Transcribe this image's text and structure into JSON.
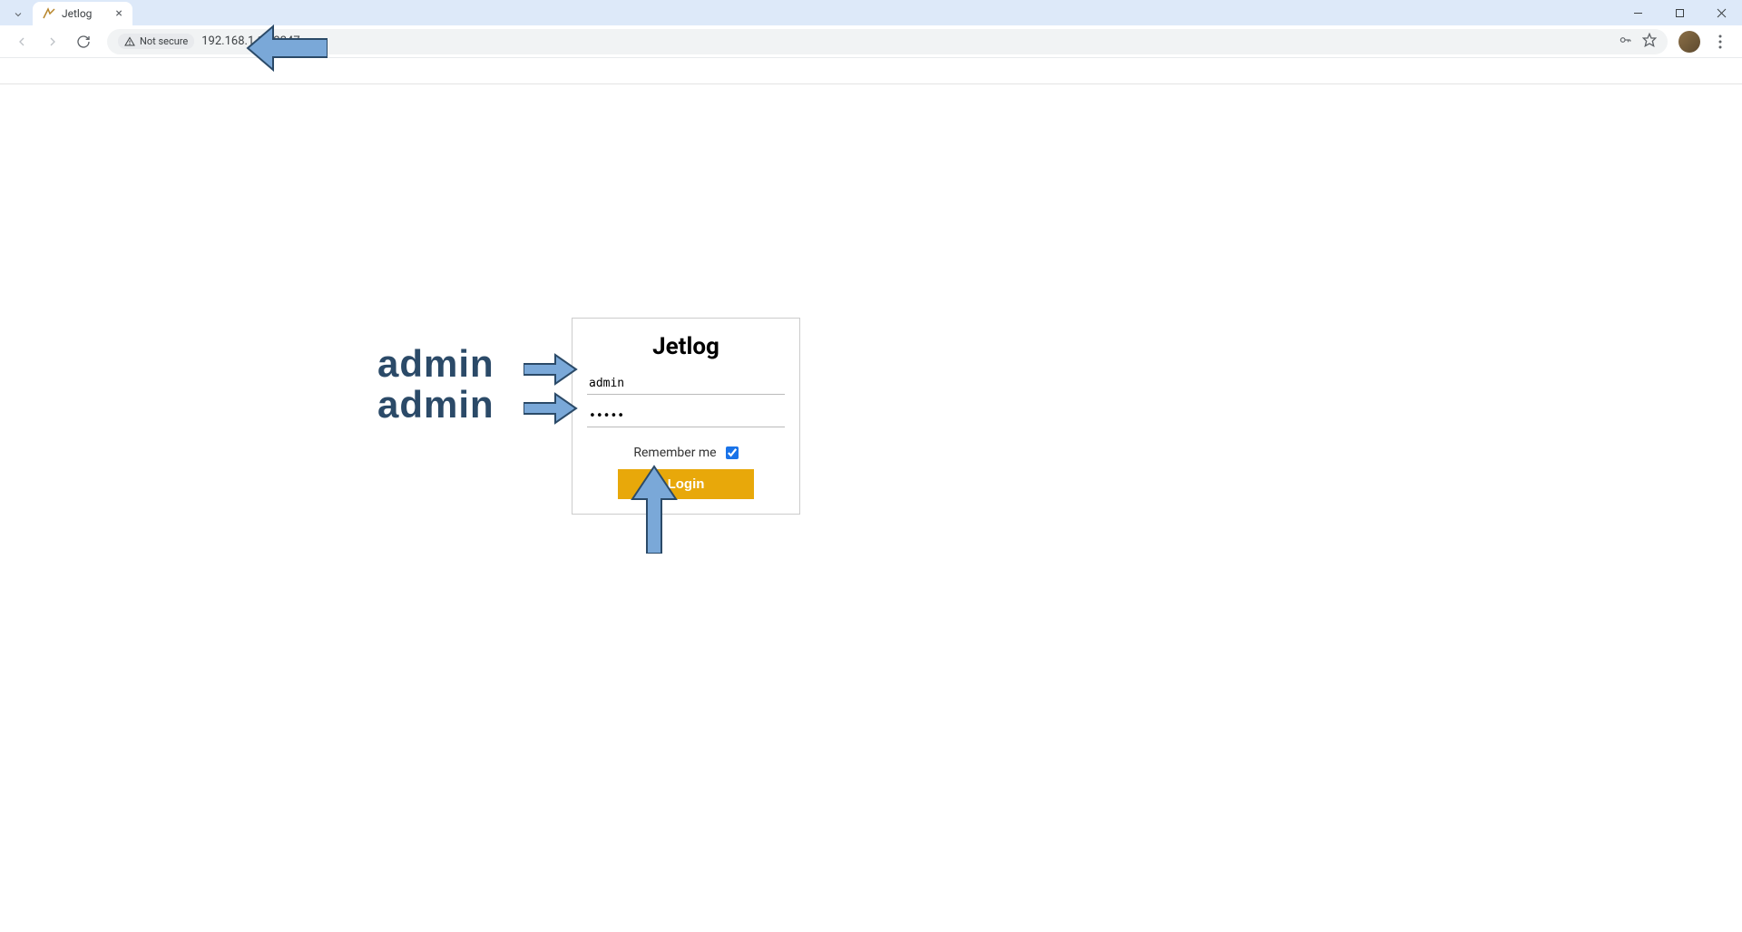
{
  "browser": {
    "tab_title": "Jetlog",
    "security_label": "Not secure",
    "url": "192.168.1.18:3347"
  },
  "login": {
    "title": "Jetlog",
    "username_value": "admin",
    "password_value": "•••••",
    "remember_label": "Remember me",
    "remember_checked": true,
    "login_button_label": "Login"
  },
  "annotations": {
    "username_hint": "admin",
    "password_hint": "admin"
  }
}
